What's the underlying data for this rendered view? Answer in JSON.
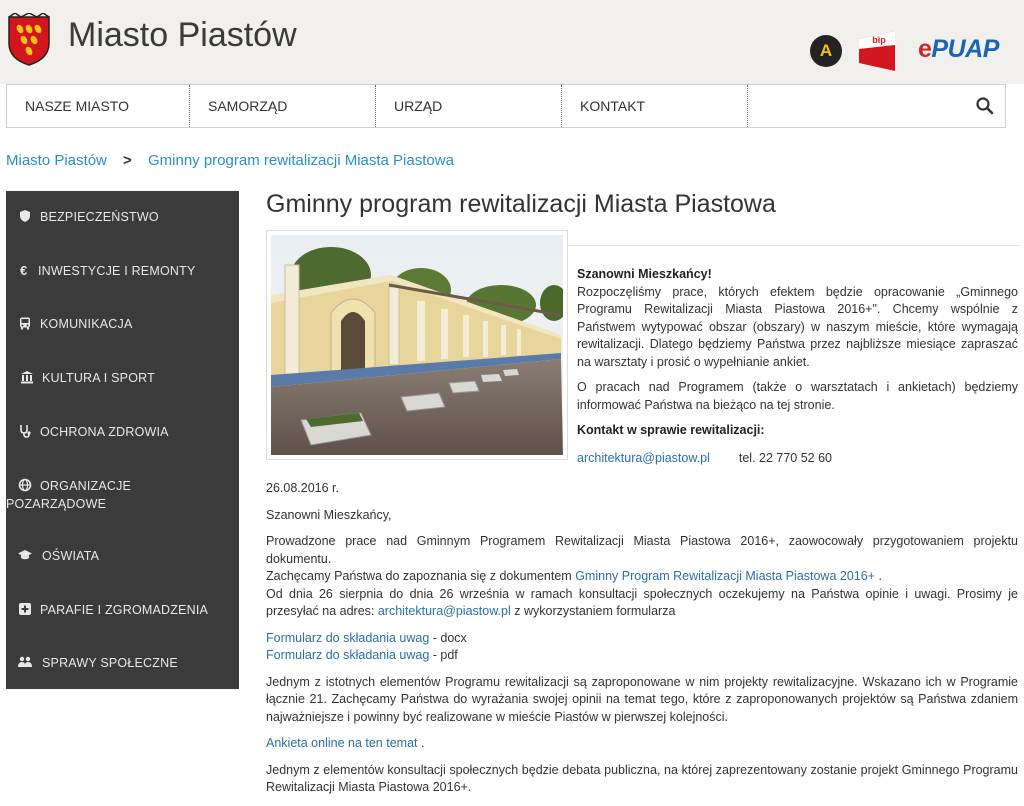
{
  "header": {
    "site_title": "Miasto Piastów",
    "accessibility_label": "A",
    "bip_label": "bip",
    "epuap_label": "ePUAP"
  },
  "nav": {
    "items": [
      "NASZE MIASTO",
      "SAMORZĄD",
      "URZĄD",
      "KONTAKT"
    ],
    "search_icon": "search-icon"
  },
  "breadcrumb": {
    "home": "Miasto Piastów",
    "separator": ">",
    "current": "Gminny program rewitalizacji Miasta Piastowa"
  },
  "sidebar": {
    "items": [
      {
        "label": "BEZPIECZEŃSTWO",
        "icon": "shield-icon"
      },
      {
        "label": "INWESTYCJE I REMONTY",
        "icon": "euro-icon"
      },
      {
        "label": "KOMUNIKACJA",
        "icon": "bus-icon"
      },
      {
        "label": "KULTURA I SPORT",
        "icon": "building-icon"
      },
      {
        "label": "OCHRONA ZDROWIA",
        "icon": "stethoscope-icon"
      },
      {
        "label": "ORGANIZACJE POZARZĄDOWE",
        "icon": "globe-icon"
      },
      {
        "label": "OŚWIATA",
        "icon": "graduation-cap-icon"
      },
      {
        "label": "PARAFIE I ZGROMADZENIA",
        "icon": "plus-square-icon"
      },
      {
        "label": "SPRAWY SPOŁECZNE",
        "icon": "users-icon"
      }
    ]
  },
  "article": {
    "title": "Gminny program rewitalizacji Miasta Piastowa",
    "intro": {
      "greeting": "Szanowni  Mieszkańcy!",
      "p1": "Rozpoczęliśmy prace, których efektem będzie opracowanie „Gminnego Programu Rewitalizacji Miasta Piastowa 2016+\". Chcemy wspólnie z Państwem wytypować obszar (obszary) w naszym mieście, które wymagają rewitalizacji. Dlatego będziemy Państwa przez najbliższe miesiące zapraszać na warsztaty  i prosić o wypełnianie ankiet.",
      "p2": "O pracach nad Programem (także o warsztatach i ankietach)  będziemy informować Państwa na bieżąco  na tej stronie.",
      "contact_heading": "Kontakt w sprawie rewitalizacji:",
      "email": "architektura@piastow.pl",
      "phone": "tel. 22 770 52 60"
    },
    "date": "26.08.2016 r.",
    "greeting2": "Szanowni Mieszkańcy,",
    "para1": "Prowadzone prace nad Gminnym Programem Rewitalizacji Miasta Piastowa 2016+,  zaowocowały przygotowaniem projektu dokumentu.",
    "para2_prefix": "Zachęcamy Państwa do zapoznania się z dokumentem ",
    "para2_link": "Gminny Program Rewitalizacji Miasta Piastowa 2016+",
    "para2_suffix": " .",
    "para3_prefix": "Od dnia 26 sierpnia do dnia 26 września w ramach konsultacji społecznych oczekujemy na Państwa opinie i uwagi. Prosimy je przesyłać na adres:  ",
    "para3_link": "architektura@piastow.pl",
    "para3_suffix": "  z wykorzystaniem formularza",
    "form_docx_link": "Formularz do składania uwag",
    "form_docx_suffix": " - docx",
    "form_pdf_link": "Formularz do składania uwag",
    "form_pdf_suffix": " - pdf",
    "para4": "Jednym z istotnych elementów Programu rewitalizacji są zaproponowane w nim projekty rewitalizacyjne. Wskazano ich w Programie łącznie 21.  Zachęcamy Państwa do wyrażania swojej opinii na temat tego, które z zaproponowanych projektów są Państwa zdaniem najważniejsze i powinny być realizowane w mieście Piastów w pierwszej kolejności.",
    "survey_link": "Ankieta online na ten temat",
    "survey_suffix": " .",
    "para5": "Jednym z elementów konsultacji społecznych będzie debata publiczna, na której zaprezentowany zostanie projekt Gminnego Programu Rewitalizacji Miasta Piastowa 2016+."
  },
  "colors": {
    "header_bg": "#f1f0ec",
    "sidebar_bg": "#3b3b3b",
    "link": "#2a6fa8",
    "breadcrumb_link": "#2a8fc7"
  }
}
